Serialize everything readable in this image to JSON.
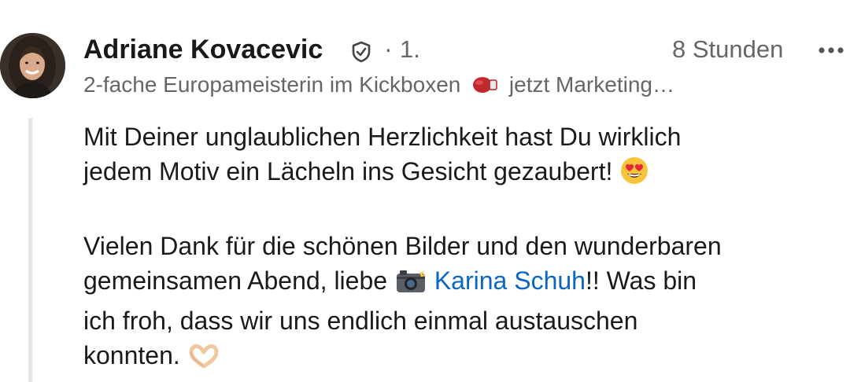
{
  "author": {
    "name": "Adriane Kovacevic",
    "verified_icon": "shield-check-icon",
    "separator": "·",
    "connection_degree": "1.",
    "headline_before_icon": "2-fache Europameisterin im Kickboxen",
    "headline_icon": "boxing-glove-icon",
    "headline_after_icon": "jetzt Marketing…"
  },
  "meta": {
    "timestamp": "8 Stunden",
    "more_icon": "more-horizontal-icon"
  },
  "comment": {
    "line1": "Mit Deiner unglaublichen Herzlichkeit hast Du wirklich",
    "line2": "jedem Motiv ein Lächeln ins Gesicht gezaubert!",
    "emoji1": "smiling-heart-eyes-icon",
    "p2_line1": "Vielen Dank für die schönen Bilder und den wunderbaren",
    "p2_line2_before": "gemeinsamen Abend, liebe",
    "camera_icon": "camera-flash-icon",
    "mention": "Karina Schuh",
    "p2_line2_after": "!! Was bin",
    "p2_line3": "ich froh, dass wir uns endlich einmal austauschen",
    "p2_line4": "konnten.",
    "emoji2": "heart-hands-icon"
  },
  "colors": {
    "mention": "#0a66c2",
    "secondary_text": "#666666",
    "thread_line": "#e6e6e6"
  }
}
